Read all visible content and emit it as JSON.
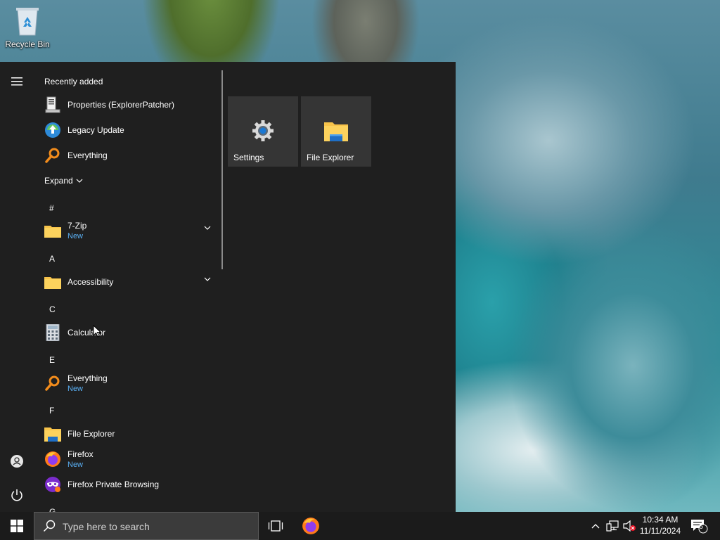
{
  "desktop": {
    "recycle_bin_label": "Recycle Bin"
  },
  "start_menu": {
    "recently_added_title": "Recently added",
    "recent_apps": [
      {
        "name": "Properties (ExplorerPatcher)",
        "icon": "properties-icon"
      },
      {
        "name": "Legacy Update",
        "icon": "legacy-update-icon"
      },
      {
        "name": "Everything",
        "icon": "everything-icon"
      }
    ],
    "expand_label": "Expand",
    "groups": [
      {
        "letter": "#",
        "apps": [
          {
            "name": "7-Zip",
            "badge": "New",
            "icon": "folder-icon",
            "expandable": true
          }
        ]
      },
      {
        "letter": "A",
        "apps": [
          {
            "name": "Accessibility",
            "badge": "",
            "icon": "folder-icon",
            "expandable": true
          }
        ]
      },
      {
        "letter": "C",
        "apps": [
          {
            "name": "Calculator",
            "badge": "",
            "icon": "calculator-icon"
          }
        ]
      },
      {
        "letter": "E",
        "apps": [
          {
            "name": "Everything",
            "badge": "New",
            "icon": "everything-icon"
          }
        ]
      },
      {
        "letter": "F",
        "apps": [
          {
            "name": "File Explorer",
            "badge": "",
            "icon": "file-explorer-icon"
          },
          {
            "name": "Firefox",
            "badge": "New",
            "icon": "firefox-icon"
          },
          {
            "name": "Firefox Private Browsing",
            "badge": "",
            "icon": "firefox-private-icon"
          }
        ]
      },
      {
        "letter": "G",
        "apps": []
      }
    ],
    "tiles": [
      {
        "label": "Settings",
        "icon": "gear-icon"
      },
      {
        "label": "File Explorer",
        "icon": "file-explorer-icon"
      }
    ]
  },
  "taskbar": {
    "search_placeholder": "Type here to search",
    "time": "10:34 AM",
    "date": "11/11/2024",
    "notification_count": "6"
  },
  "colors": {
    "start_bg": "#1f1f1f",
    "tile_bg": "#353535",
    "taskbar_bg": "#1b1b1b",
    "new_badge": "#5ab0f5"
  }
}
